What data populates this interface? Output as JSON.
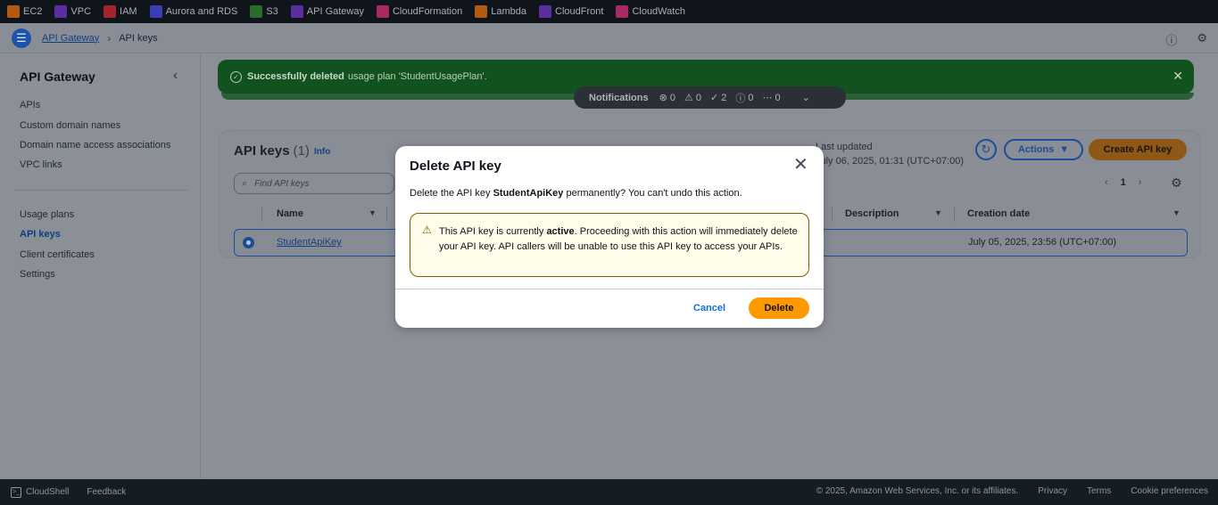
{
  "topbar": {
    "services": [
      {
        "label": "EC2",
        "icon": "ec2-icon",
        "color": "#b35a12"
      },
      {
        "label": "VPC",
        "icon": "vpc-icon",
        "color": "#5a2f9e"
      },
      {
        "label": "IAM",
        "icon": "iam-icon",
        "color": "#a1242f"
      },
      {
        "label": "Aurora and RDS",
        "icon": "rds-icon",
        "color": "#3a3fb3"
      },
      {
        "label": "S3",
        "icon": "s3-icon",
        "color": "#2b6b2b"
      },
      {
        "label": "API Gateway",
        "icon": "api-gateway-icon",
        "color": "#5a2f9e"
      },
      {
        "label": "CloudFormation",
        "icon": "cloudformation-icon",
        "color": "#a62a63"
      },
      {
        "label": "Lambda",
        "icon": "lambda-icon",
        "color": "#b35a12"
      },
      {
        "label": "CloudFront",
        "icon": "cloudfront-icon",
        "color": "#5a2f9e"
      },
      {
        "label": "CloudWatch",
        "icon": "cloudwatch-icon",
        "color": "#a62a63"
      }
    ]
  },
  "breadcrumb": {
    "parent": "API Gateway",
    "separator": "›",
    "current": "API keys"
  },
  "sidebar": {
    "title": "API Gateway",
    "items": [
      "APIs",
      "Custom domain names",
      "Domain name access associations",
      "VPC links"
    ],
    "items2": [
      "Usage plans",
      "API keys",
      "Client certificates",
      "Settings"
    ],
    "active": "API keys"
  },
  "banner": {
    "bold": "Successfully deleted",
    "text": "usage plan 'StudentUsagePlan'."
  },
  "notifications": {
    "label": "Notifications",
    "counts": [
      {
        "icon": "error-icon",
        "glyph": "⊗",
        "value": "0"
      },
      {
        "icon": "warning-icon",
        "glyph": "⚠",
        "value": "0"
      },
      {
        "icon": "success-icon",
        "glyph": "✓",
        "value": "2"
      },
      {
        "icon": "info-icon",
        "glyph": "ⓘ",
        "value": "0"
      },
      {
        "icon": "in-progress-icon",
        "glyph": "⋯",
        "value": "0"
      }
    ]
  },
  "panel": {
    "title": "API keys",
    "count": "(1)",
    "info": "Info",
    "last_updated_label": "Last updated",
    "last_updated_value": "July 06, 2025, 01:31 (UTC+07:00)",
    "actions_label": "Actions",
    "create_label": "Create API key",
    "search_placeholder": "Find API keys",
    "page": "1",
    "columns": {
      "name": "Name",
      "description": "Description",
      "creation_date": "Creation date"
    },
    "rows": [
      {
        "name": "StudentApiKey",
        "creation_date": "July 05, 2025, 23:56 (UTC+07:00)"
      }
    ]
  },
  "modal": {
    "title": "Delete API key",
    "desc_before": "Delete the API key ",
    "desc_key": "StudentApiKey",
    "desc_after": " permanently? You can't undo this action.",
    "warn_before": "This API key is currently ",
    "warn_bold": "active",
    "warn_after": ". Proceeding with this action will immediately delete your API key. API callers will be unable to use this API key to access your APIs.",
    "cancel_label": "Cancel",
    "delete_label": "Delete"
  },
  "footer": {
    "cloudshell": "CloudShell",
    "feedback": "Feedback",
    "copyright": "© 2025, Amazon Web Services, Inc. or its affiliates.",
    "privacy": "Privacy",
    "terms": "Terms",
    "cookies": "Cookie preferences"
  }
}
